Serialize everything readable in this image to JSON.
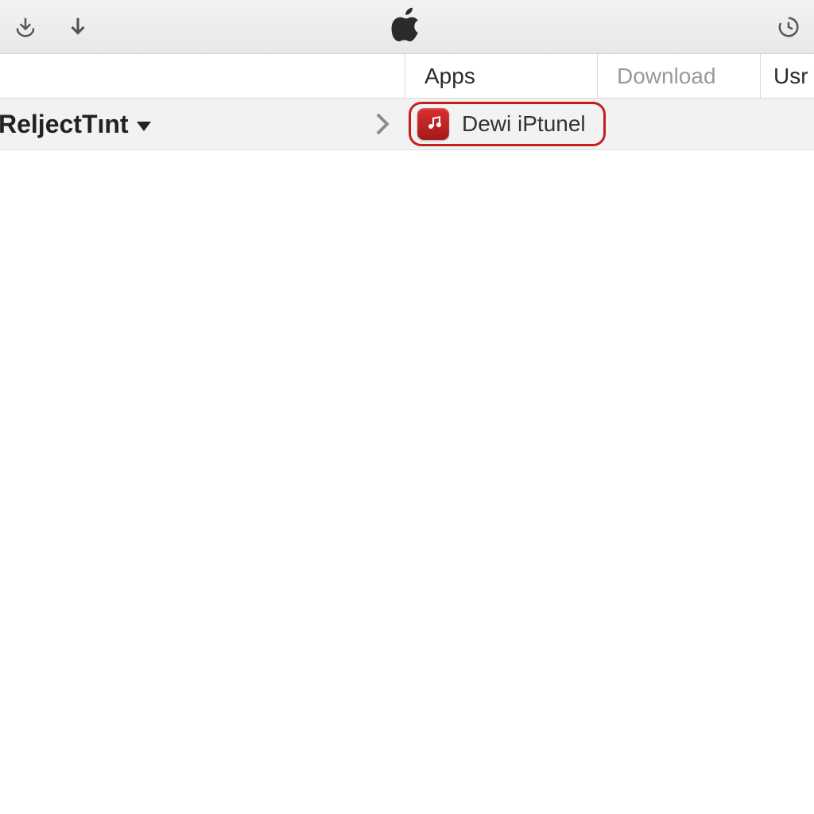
{
  "toolbar": {
    "download_tray_icon": "download-tray-icon",
    "download_arrow_icon": "download-arrow-icon",
    "apple_icon": "apple-logo-icon",
    "history_icon": "history-clock-icon"
  },
  "tabs": [
    {
      "label": "Apps",
      "active": true
    },
    {
      "label": "Download",
      "active": false
    },
    {
      "label": "Usr",
      "active": true
    }
  ],
  "breadcrumb": {
    "dropdown_label": "ReljectTınt",
    "item_label": "Dewi iPtunel",
    "item_icon": "music-note-icon"
  }
}
